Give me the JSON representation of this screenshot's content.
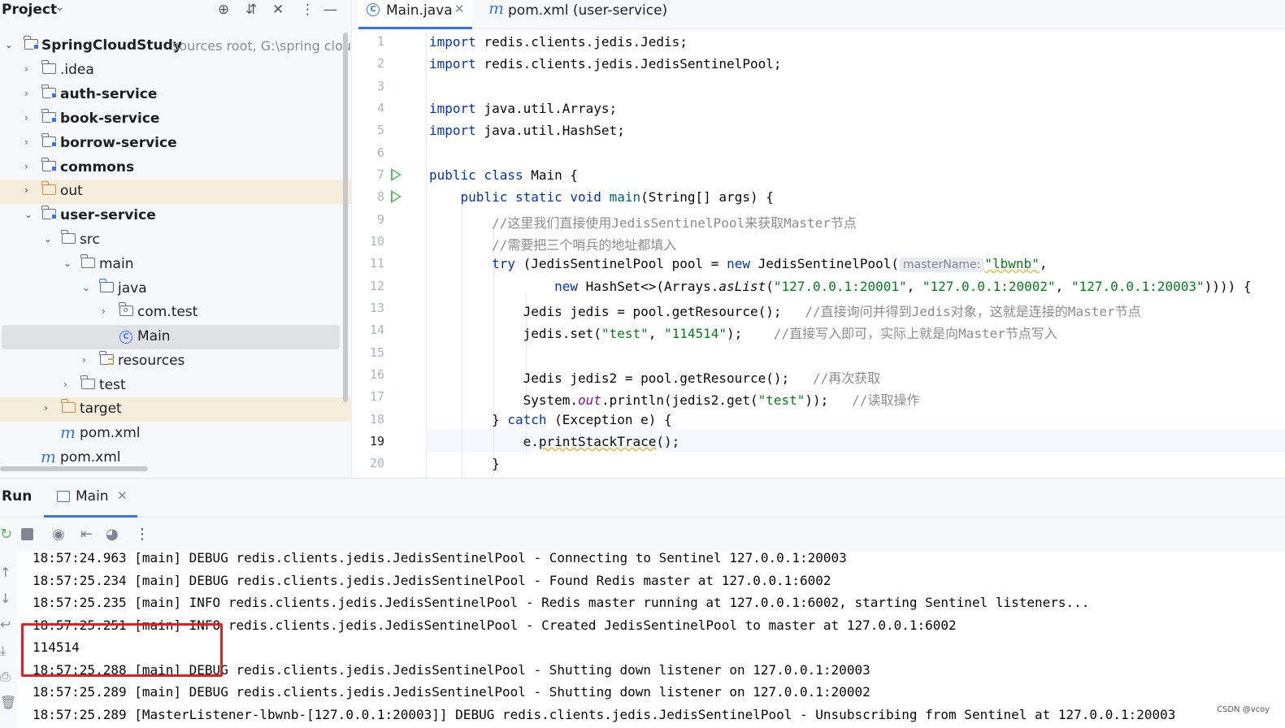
{
  "project": {
    "title": "Project",
    "tree": [
      {
        "label": "SpringCloudStudy",
        "hint": "sources root,  G:\\spring clou",
        "type": "module-root"
      },
      {
        "label": ".idea",
        "type": "folder"
      },
      {
        "label": "auth-service",
        "type": "module"
      },
      {
        "label": "book-service",
        "type": "module"
      },
      {
        "label": "borrow-service",
        "type": "module"
      },
      {
        "label": "commons",
        "type": "module"
      },
      {
        "label": "out",
        "type": "excluded"
      },
      {
        "label": "user-service",
        "type": "module"
      },
      {
        "label": "src",
        "type": "folder"
      },
      {
        "label": "main",
        "type": "folder"
      },
      {
        "label": "java",
        "type": "source"
      },
      {
        "label": "com.test",
        "type": "package"
      },
      {
        "label": "Main",
        "type": "class"
      },
      {
        "label": "resources",
        "type": "resources"
      },
      {
        "label": "test",
        "type": "folder"
      },
      {
        "label": "target",
        "type": "excluded"
      },
      {
        "label": "pom.xml",
        "type": "maven"
      },
      {
        "label": "pom.xml",
        "type": "maven"
      }
    ]
  },
  "editor": {
    "tabs": [
      {
        "label": "Main.java",
        "icon": "class-icon",
        "active": true
      },
      {
        "label": "pom.xml (user-service)",
        "icon": "maven-icon",
        "active": false
      }
    ],
    "line_numbers": [
      "1",
      "2",
      "3",
      "4",
      "5",
      "6",
      "7",
      "8",
      "9",
      "10",
      "11",
      "12",
      "13",
      "14",
      "15",
      "16",
      "17",
      "18",
      "19",
      "20"
    ],
    "current_line": "19",
    "code": {
      "l1a": "import",
      "l1b": " redis.clients.jedis.Jedis;",
      "l2a": "import",
      "l2b": " redis.clients.jedis.JedisSentinelPool;",
      "l4a": "import",
      "l4b": " java.util.Arrays;",
      "l5a": "import",
      "l5b": " java.util.HashSet;",
      "l7a": "public class",
      "l7b": " Main {",
      "l8a": "    public static void ",
      "l8b": "main",
      "l8c": "(String[] args) {",
      "l9": "        //这里我们直接使用JedisSentinelPool来获取Master节点",
      "l10": "        //需要把三个哨兵的地址都填入",
      "l11a": "        try",
      "l11b": " (JedisSentinelPool pool = ",
      "l11c": "new",
      "l11d": " JedisSentinelPool(",
      "l11hint": "masterName:",
      "l11e": "\"lbwnb\"",
      "l11f": ",",
      "l12a": "                new",
      "l12b": " HashSet<>(Arrays.",
      "l12c": "asList",
      "l12d": "(",
      "l12e": "\"127.0.0.1:20001\"",
      "l12f": ", ",
      "l12g": "\"127.0.0.1:20002\"",
      "l12h": ", ",
      "l12i": "\"127.0.0.1:20003\"",
      "l12j": ")))) {",
      "l13a": "            Jedis jedis = pool.getResource();   ",
      "l13b": "//直接询问并得到Jedis对象，这就是连接的Master节点",
      "l14a": "            jedis.set(",
      "l14b": "\"test\"",
      "l14c": ", ",
      "l14d": "\"114514\"",
      "l14e": ");    ",
      "l14f": "//直接写入即可，实际上就是向Master节点写入",
      "l16a": "            Jedis jedis2 = pool.getResource();   ",
      "l16b": "//再次获取",
      "l17a": "            System.",
      "l17b": "out",
      "l17c": ".println(jedis2.get(",
      "l17d": "\"test\"",
      "l17e": "));   ",
      "l17f": "//读取操作",
      "l18a": "        } ",
      "l18b": "catch",
      "l18c": " (Exception e) {",
      "l19a": "            e.",
      "l19b": "printStackTrace",
      "l19c": "();",
      "l20": "        }"
    }
  },
  "run": {
    "title": "Run",
    "tab_label": "Main",
    "console": [
      "18:57:24.963 [main] DEBUG redis.clients.jedis.JedisSentinelPool - Connecting to Sentinel 127.0.0.1:20003",
      "18:57:25.234 [main] DEBUG redis.clients.jedis.JedisSentinelPool - Found Redis master at 127.0.0.1:6002",
      "18:57:25.235 [main] INFO redis.clients.jedis.JedisSentinelPool - Redis master running at 127.0.0.1:6002, starting Sentinel listeners...",
      "18:57:25.251 [main] INFO redis.clients.jedis.JedisSentinelPool - Created JedisSentinelPool to master at 127.0.0.1:6002",
      "114514",
      "18:57:25.288 [main] DEBUG redis.clients.jedis.JedisSentinelPool - Shutting down listener on 127.0.0.1:20003",
      "18:57:25.289 [main] DEBUG redis.clients.jedis.JedisSentinelPool - Shutting down listener on 127.0.0.1:20002",
      "18:57:25.289 [MasterListener-lbwnb-[127.0.0.1:20003]] DEBUG redis.clients.jedis.JedisSentinelPool - Unsubscribing from Sentinel at 127.0.0.1:20003"
    ]
  },
  "watermark": "CSDN @vcoy",
  "colors": {
    "accent": "#3574f0",
    "keyword": "#0033b3",
    "string": "#067d17",
    "comment": "#8c8c8c",
    "highlight_box": "#e02020"
  }
}
